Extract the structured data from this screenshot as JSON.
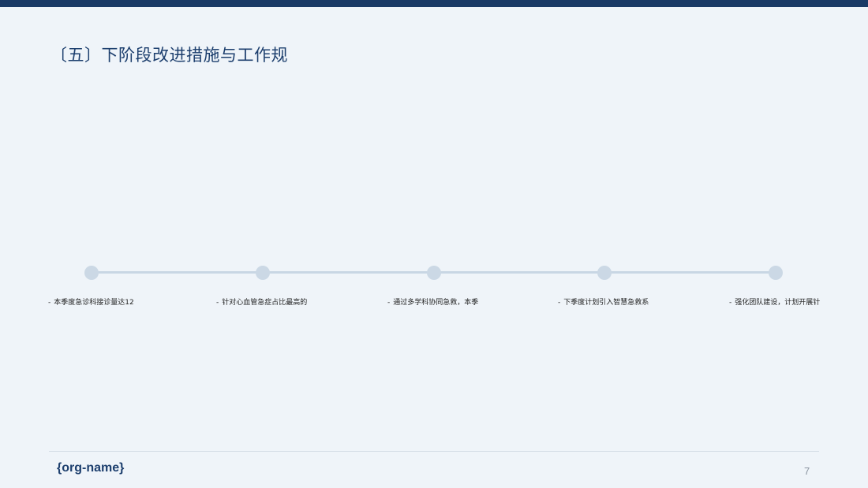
{
  "slide": {
    "title": "〔五〕下阶段改进措施与工作规",
    "org_name": "{org-name}",
    "page_number": "7"
  },
  "timeline": {
    "items": [
      {
        "dash": "-",
        "text": "本季度急诊科接诊量达12"
      },
      {
        "dash": "-",
        "text": "针对心血管急症占比最高的"
      },
      {
        "dash": "-",
        "text": "通过多学科协同急救，本季"
      },
      {
        "dash": "-",
        "text": "下季度计划引入智慧急救系"
      },
      {
        "dash": "-",
        "text": "强化团队建设，计划开展针"
      }
    ]
  },
  "colors": {
    "top_bar": "#1a3a66",
    "title": "#1d3f6e",
    "background": "#eff4f9",
    "timeline": "#c8d6e4"
  }
}
